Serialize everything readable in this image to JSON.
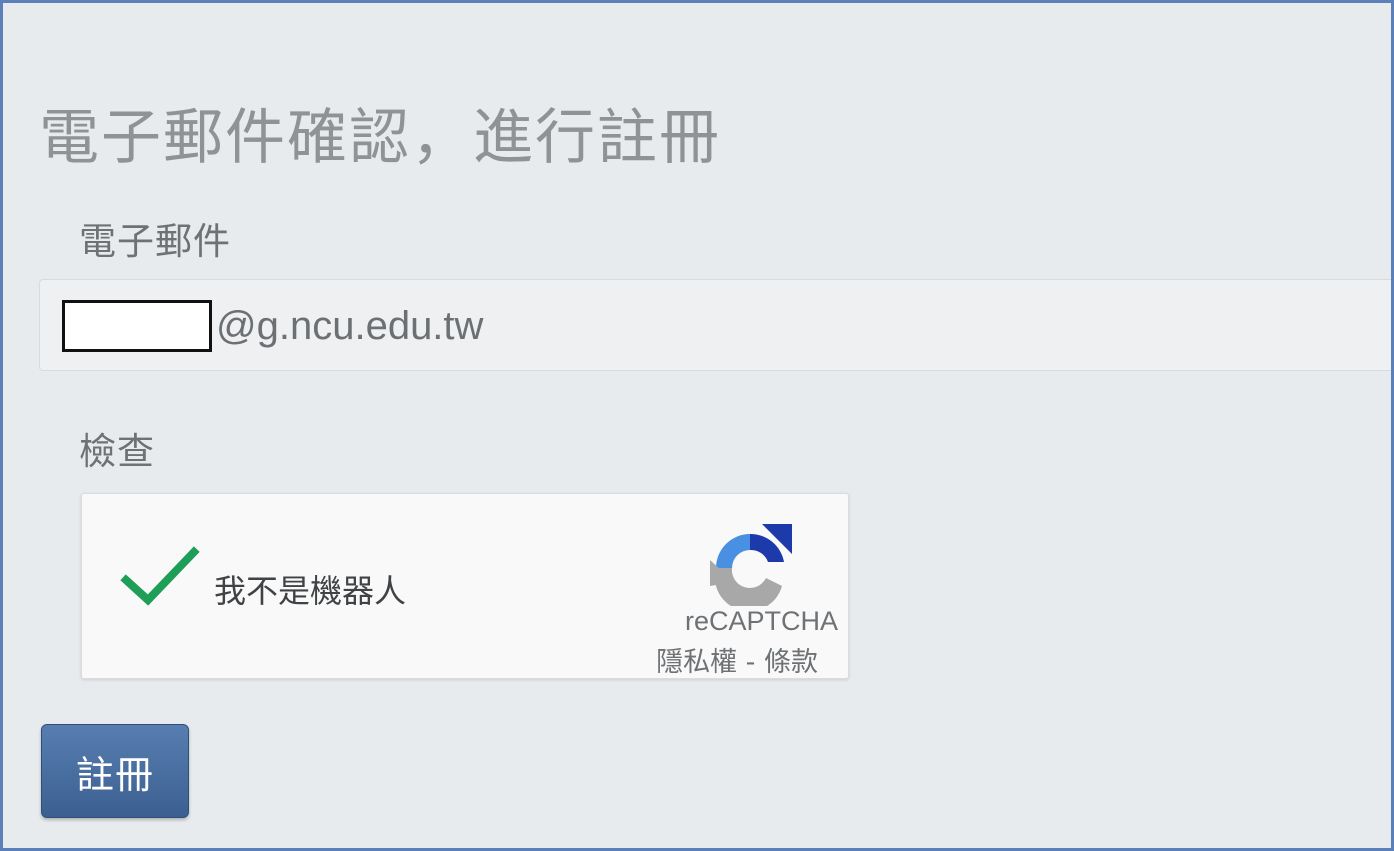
{
  "form": {
    "title": "電子郵件確認，進行註冊",
    "email_label": "電子郵件",
    "email_value": "",
    "email_domain": "@g.ncu.edu.tw",
    "check_label": "檢查",
    "submit_label": "註冊"
  },
  "recaptcha": {
    "label": "我不是機器人",
    "brand": "reCAPTCHA",
    "privacy_link": "隱私權",
    "separator": " - ",
    "terms_link": "條款",
    "checkmark_icon": "checkmark-icon",
    "logo_icon": "recaptcha-logo-icon",
    "checkmark_color": "#1e9e57",
    "logo_blue": "#1c3aa9",
    "logo_light_blue": "#4a90e2",
    "logo_gray": "#a8a8a8"
  },
  "colors": {
    "page_background": "#e8ebee",
    "frame_border": "#5b7fb8",
    "button_background": "#4a6fa5",
    "button_text": "#ffffff"
  }
}
